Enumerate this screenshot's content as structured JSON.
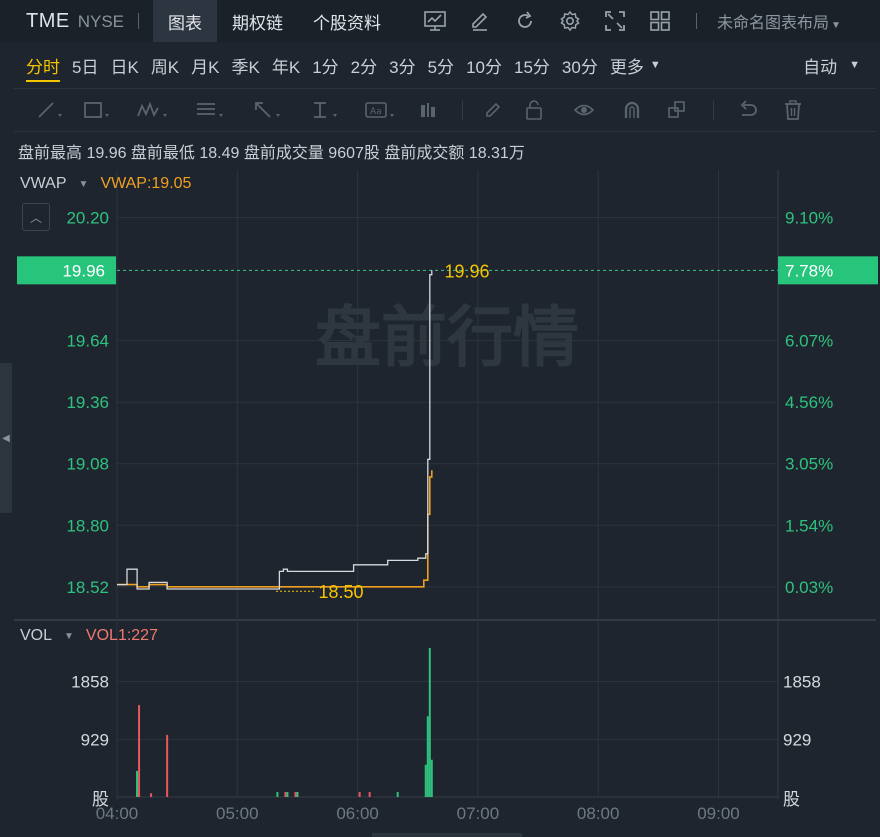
{
  "header": {
    "symbol": "TME",
    "exchange": "NYSE",
    "tabs": [
      "图表",
      "期权链",
      "个股资料"
    ],
    "active_tab": 0,
    "icons": [
      "indicator-chart-icon",
      "pencil-icon",
      "refresh-icon",
      "gear-icon",
      "fullscreen-icon",
      "grid-layout-icon"
    ],
    "layout_name": "未命名图表布局"
  },
  "periods": {
    "items": [
      "分时",
      "5日",
      "日K",
      "周K",
      "月K",
      "季K",
      "年K",
      "1分",
      "2分",
      "3分",
      "5分",
      "10分",
      "15分",
      "30分"
    ],
    "active": 0,
    "more_label": "更多",
    "scale_label": "自动"
  },
  "drawing_tools": [
    "line-tool-icon",
    "rectangle-tool-icon",
    "wave-tool-icon",
    "fib-tool-icon",
    "arrow-tool-icon",
    "text-cursor-tool-icon",
    "text-box-tool-icon",
    "measure-tool-icon",
    "brush-icon",
    "lock-icon",
    "eye-icon",
    "magnet-icon",
    "clone-icon",
    "undo-icon",
    "trash-icon"
  ],
  "info": {
    "text": "盘前最高 19.96 盘前最低 18.49 盘前成交量 9607股 盘前成交额 18.31万"
  },
  "price_panel": {
    "legend_name": "VWAP",
    "legend_value": "VWAP:19.05",
    "y_ticks": [
      "20.20",
      "19.64",
      "19.36",
      "19.08",
      "18.80",
      "18.52"
    ],
    "y_pct_ticks": [
      "9.10%",
      "6.07%",
      "4.56%",
      "3.05%",
      "1.54%",
      "0.03%"
    ],
    "current_price": "19.96",
    "current_pct": "7.78%",
    "high_label": "19.96",
    "low_label": "18.50",
    "watermark": "盘前行情"
  },
  "volume_panel": {
    "legend_name": "VOL",
    "legend_value": "VOL1:227",
    "y_ticks": [
      "1858",
      "929"
    ],
    "unit": "股"
  },
  "x_ticks": [
    "04:00",
    "05:00",
    "06:00",
    "07:00",
    "08:00",
    "09:00"
  ],
  "colors": {
    "background": "#1e252e",
    "grid": "#2c343d",
    "price_line": "#d6d9dd",
    "vwap_line": "#f0a020",
    "up": "#2ec27e",
    "down": "#e8575c",
    "axis_green": "#2ec27e",
    "highlight_label": "#f5c400",
    "current_badge": "#27c47c"
  },
  "chart_data": [
    {
      "type": "line",
      "title": "",
      "series": [
        {
          "name": "",
          "x": [
            "04:00",
            "04:05",
            "04:09",
            "04:10",
            "04:15",
            "04:16",
            "04:25",
            "05:00",
            "05:20",
            "05:21",
            "05:23",
            "05:25",
            "05:30",
            "05:40",
            "05:50",
            "05:58",
            "06:00",
            "06:10",
            "06:15",
            "06:20",
            "06:30",
            "06:34",
            "06:35",
            "06:36",
            "06:37"
          ],
          "values": [
            18.53,
            18.6,
            18.6,
            18.51,
            18.51,
            18.54,
            18.51,
            18.51,
            18.51,
            18.59,
            18.6,
            18.59,
            18.59,
            18.59,
            18.59,
            18.62,
            18.62,
            18.62,
            18.64,
            18.64,
            18.65,
            18.67,
            19.1,
            19.94,
            19.96
          ]
        },
        {
          "name": "VWAP",
          "x": [
            "04:00",
            "04:05",
            "04:09",
            "04:10",
            "04:15",
            "04:16",
            "04:25",
            "05:00",
            "05:30",
            "06:00",
            "06:30",
            "06:33",
            "06:35",
            "06:36",
            "06:37"
          ],
          "values": [
            18.53,
            18.53,
            18.53,
            18.52,
            18.52,
            18.53,
            18.52,
            18.52,
            18.52,
            18.52,
            18.52,
            18.55,
            18.85,
            19.02,
            19.05
          ]
        }
      ],
      "y_range": [
        18.46,
        20.28
      ],
      "grid": true
    },
    {
      "type": "bar",
      "title": "",
      "x": [
        "04:10",
        "04:11",
        "04:17",
        "04:25",
        "05:20",
        "05:24",
        "05:25",
        "05:29",
        "05:30",
        "06:01",
        "06:06",
        "06:20",
        "06:34",
        "06:35",
        "06:36",
        "06:37"
      ],
      "values": [
        420,
        1480,
        60,
        1000,
        80,
        80,
        80,
        80,
        80,
        80,
        80,
        80,
        520,
        1300,
        2400,
        600
      ],
      "directions": [
        "up",
        "down",
        "down",
        "down",
        "up",
        "down",
        "up",
        "down",
        "up",
        "down",
        "down",
        "up",
        "up",
        "up",
        "up",
        "up"
      ],
      "y_range": [
        0,
        2400
      ],
      "grid": true
    }
  ]
}
